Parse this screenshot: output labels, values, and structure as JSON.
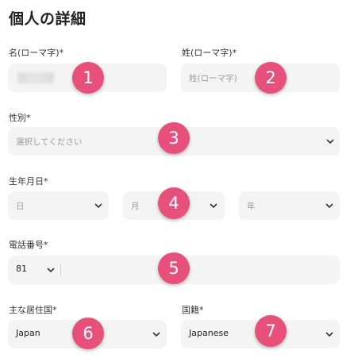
{
  "title": "個人の詳細",
  "first_name": {
    "label": "名(ローマ字)*"
  },
  "last_name": {
    "label": "姓(ローマ字)*",
    "placeholder": "姓(ローマ字)"
  },
  "gender": {
    "label": "性別*",
    "placeholder": "選択してください"
  },
  "birthdate": {
    "label": "生年月日*",
    "day": "日",
    "month": "月",
    "year": "年"
  },
  "phone": {
    "label": "電話番号*",
    "country_code": "81"
  },
  "residence": {
    "label": "主な居住国*",
    "value": "Japan"
  },
  "nationality": {
    "label": "国籍*",
    "value": "Japanese"
  },
  "badges": [
    "1",
    "2",
    "3",
    "4",
    "5",
    "6",
    "7"
  ],
  "colors": {
    "badge": "#e8507c",
    "field_bg": "#f4f4f4"
  },
  "icons": [
    "chevron-down-icon"
  ]
}
